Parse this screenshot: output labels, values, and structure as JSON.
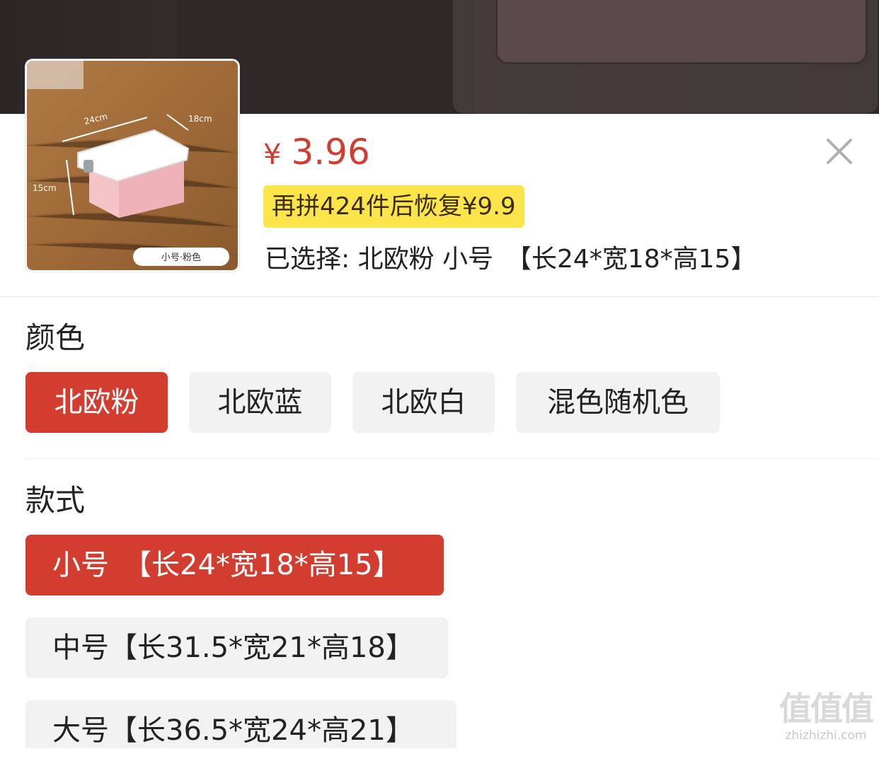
{
  "product": {
    "thumbnail_label": "小号·粉色",
    "thumbnail_dims": {
      "length": "24cm",
      "width": "18cm",
      "height": "15cm"
    }
  },
  "price": {
    "symbol": "¥",
    "value": "3.96"
  },
  "promo_text": "再拼424件后恢复¥9.9",
  "selected_text": "已选择: 北欧粉 小号　【长24*宽18*高15】",
  "color_section": {
    "title": "颜色",
    "options": [
      {
        "label": "北欧粉",
        "selected": true
      },
      {
        "label": "北欧蓝",
        "selected": false
      },
      {
        "label": "北欧白",
        "selected": false
      },
      {
        "label": "混色随机色",
        "selected": false
      }
    ]
  },
  "style_section": {
    "title": "款式",
    "options": [
      {
        "label": "小号　【长24*宽18*高15】",
        "selected": true
      },
      {
        "label": "中号【长31.5*宽21*高18】",
        "selected": false
      },
      {
        "label": "大号【长36.5*宽24*高21】",
        "selected": false
      }
    ]
  },
  "watermark": {
    "big": "值值值",
    "small": "zhizhizhi.com"
  },
  "colors": {
    "accent_red": "#d33d2f",
    "promo_yellow": "#fbe54a",
    "chip_gray": "#f2f2f2"
  },
  "icons": {
    "close": "close-icon"
  }
}
